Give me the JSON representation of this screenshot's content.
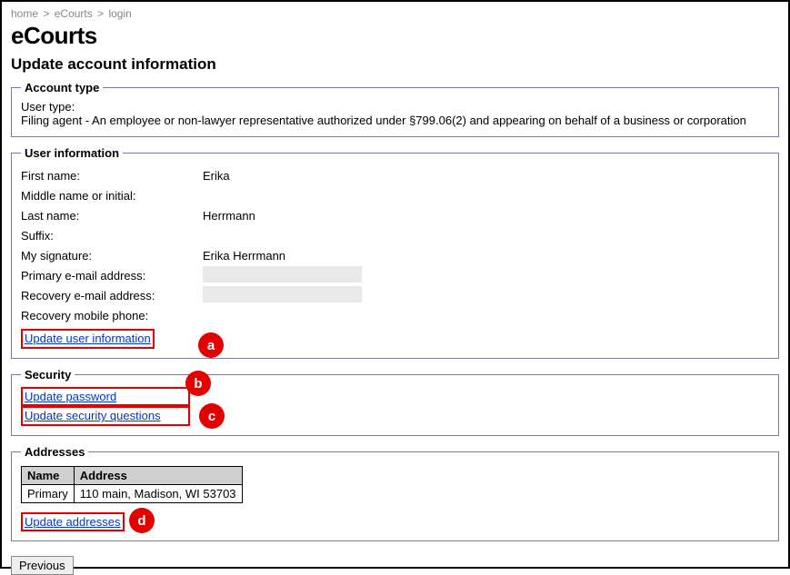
{
  "breadcrumb": {
    "home": "home",
    "ecourts": "eCourts",
    "login": "login"
  },
  "page_title": "eCourts",
  "page_subtitle": "Update account information",
  "account_type": {
    "legend": "Account type",
    "user_type_label": "User type:",
    "user_type_value": "Filing agent - An employee or non-lawyer representative authorized under §799.06(2) and appearing on behalf of a business or corporation"
  },
  "user_info": {
    "legend": "User information",
    "rows": {
      "first_name_label": "First name:",
      "first_name_value": "Erika",
      "middle_label": "Middle name or initial:",
      "middle_value": "",
      "last_name_label": "Last name:",
      "last_name_value": "Herrmann",
      "suffix_label": "Suffix:",
      "suffix_value": "",
      "signature_label": "My signature:",
      "signature_value": "Erika Herrmann",
      "primary_email_label": "Primary e-mail address:",
      "recovery_email_label": "Recovery e-mail address:",
      "recovery_phone_label": "Recovery mobile phone:"
    },
    "update_link": "Update user information"
  },
  "security": {
    "legend": "Security",
    "update_password": "Update password",
    "update_questions": "Update security questions"
  },
  "addresses": {
    "legend": "Addresses",
    "headers": {
      "name": "Name",
      "address": "Address"
    },
    "row": {
      "name": "Primary",
      "address": "110 main, Madison, WI 53703"
    },
    "update_link": "Update addresses"
  },
  "previous_button": "Previous",
  "callouts": {
    "a": "a",
    "b": "b",
    "c": "c",
    "d": "d"
  }
}
